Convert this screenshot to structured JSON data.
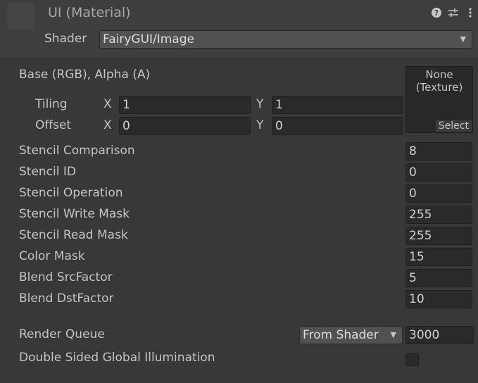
{
  "header": {
    "title": "UI (Material)",
    "icons": [
      "help-icon",
      "preset-sliders-icon",
      "more-vertical-icon"
    ]
  },
  "shader": {
    "label": "Shader",
    "value": "FairyGUI/Image"
  },
  "texture": {
    "label": "Base (RGB), Alpha (A)",
    "preview_text_line1": "None",
    "preview_text_line2": "(Texture)",
    "select_label": "Select",
    "tiling": {
      "label": "Tiling",
      "x_label": "X",
      "x": "1",
      "y_label": "Y",
      "y": "1"
    },
    "offset": {
      "label": "Offset",
      "x_label": "X",
      "x": "0",
      "y_label": "Y",
      "y": "0"
    }
  },
  "properties": [
    {
      "label": "Stencil Comparison",
      "value": "8"
    },
    {
      "label": "Stencil ID",
      "value": "0"
    },
    {
      "label": "Stencil Operation",
      "value": "0"
    },
    {
      "label": "Stencil Write Mask",
      "value": "255"
    },
    {
      "label": "Stencil Read Mask",
      "value": "255"
    },
    {
      "label": "Color Mask",
      "value": "15"
    },
    {
      "label": "Blend SrcFactor",
      "value": "5"
    },
    {
      "label": "Blend DstFactor",
      "value": "10"
    }
  ],
  "render_queue": {
    "label": "Render Queue",
    "mode": "From Shader",
    "value": "3000"
  },
  "gi": {
    "label": "Double Sided Global Illumination",
    "checked": false
  }
}
